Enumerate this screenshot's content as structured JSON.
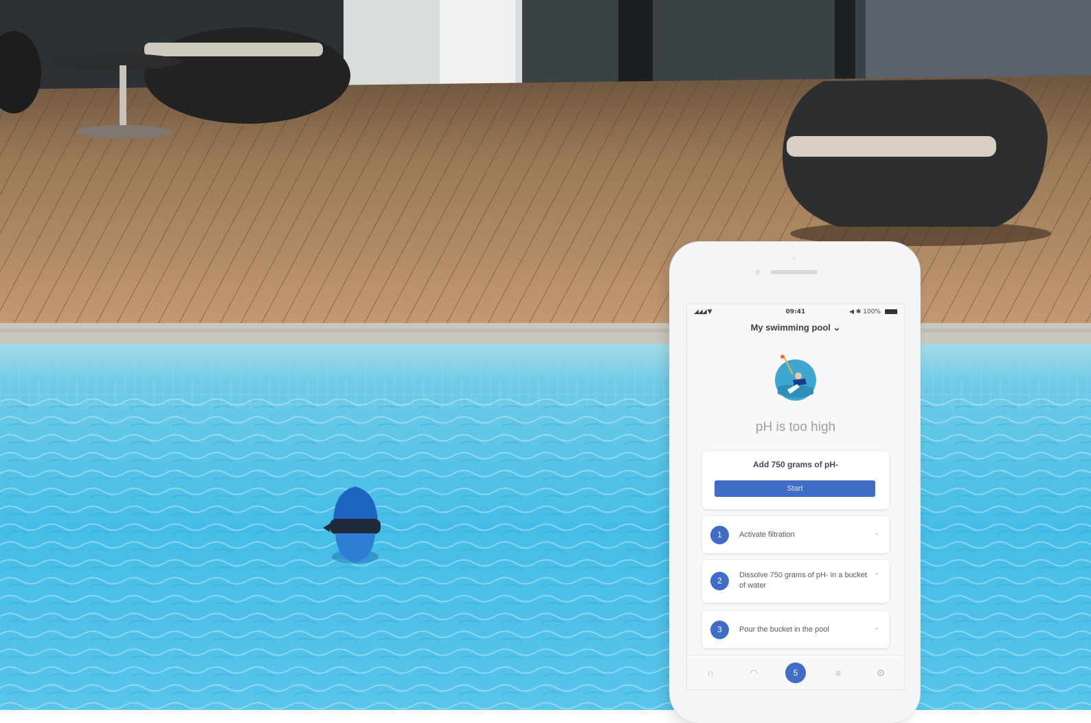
{
  "phone": {
    "status_bar": {
      "signal": "◢◢◢ ▼",
      "time": "09:41",
      "battery": "◀ ✱ 100%"
    },
    "pool_selector": "My swimming pool ⌄",
    "alert": "pH is too high",
    "dose_instruction": "Add 750 grams of pH-",
    "start_button": "Start",
    "steps": [
      {
        "number": "1",
        "text": "Activate filtration",
        "chevron": "⌄"
      },
      {
        "number": "2",
        "text": "Dissolve 750 grams of pH- in a bucket of water",
        "chevron": "⌃"
      },
      {
        "number": "3",
        "text": "Pour the bucket in the pool",
        "chevron": "⌄"
      }
    ],
    "tabs": [
      {
        "icon": "people-icon",
        "glyph": "∩"
      },
      {
        "icon": "gauge-icon",
        "glyph": "◠"
      },
      {
        "icon": "guide-icon",
        "glyph": "5"
      },
      {
        "icon": "list-icon",
        "glyph": "≡"
      },
      {
        "icon": "settings-icon",
        "glyph": "⚙"
      }
    ]
  },
  "colors": {
    "accent": "#3f6cc6",
    "pool_water": "#4ec3e8",
    "deck_wood": "#a57e58"
  }
}
